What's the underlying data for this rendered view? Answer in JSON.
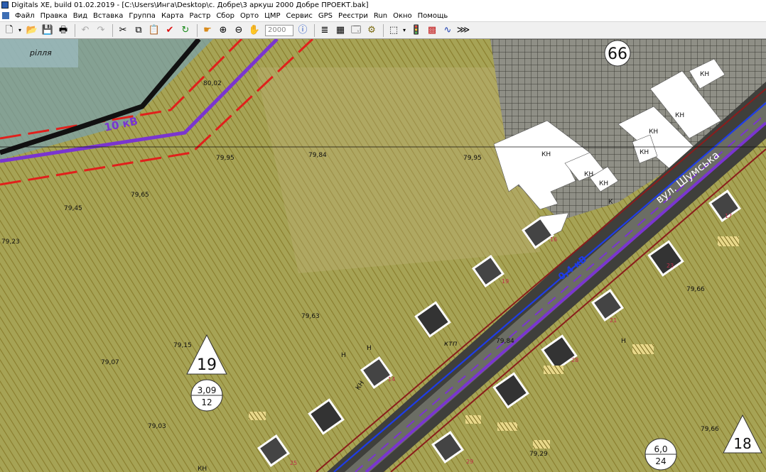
{
  "window": {
    "title": "Digitals XE, build 01.02.2019 - [C:\\Users\\Инга\\Desktop\\с. Добре\\3 аркуш 2000 Добре ПРОЕКТ.bak]"
  },
  "menu": [
    "Файл",
    "Правка",
    "Вид",
    "Вставка",
    "Группа",
    "Карта",
    "Растр",
    "Сбор",
    "Орто",
    "ЦМР",
    "Сервис",
    "GPS",
    "Реєстри",
    "Run",
    "Окно",
    "Помощь"
  ],
  "toolbar": {
    "zoom_value": "2000",
    "icons": [
      "new-file-icon",
      "open-folder-icon",
      "save-icon",
      "print-icon",
      "undo-icon",
      "redo-icon",
      "cut-icon",
      "copy-icon",
      "paste-icon",
      "check-icon",
      "refresh-icon",
      "pointer-hand-icon",
      "zoom-in-icon",
      "zoom-out-icon",
      "pan-hand-icon",
      "info-icon",
      "layers-icon",
      "table-icon",
      "properties-icon",
      "gear-icon",
      "select-arrow-icon",
      "traffic-light-icon",
      "raster-icon",
      "curve-icon",
      "vector-icon"
    ]
  },
  "map": {
    "colors": {
      "field": "#a6a355",
      "hatch": "#8a7d2c",
      "red_line": "#e0201c",
      "purple_line": "#7a35d0",
      "blue_line": "#1e3ce8",
      "road": "#3b3b3b",
      "dark_red_border": "#8b1c1c"
    },
    "labels": {
      "field": "рілля",
      "street": "вул. Шумська",
      "power_line": "10 кВ",
      "power_line_road": "0,4 кВ",
      "block_66": "66",
      "block_19": "19",
      "block_18": "18",
      "area_19_top": "3,09",
      "area_19_bottom": "12",
      "area_18_top": "6,0",
      "area_18_bottom": "24",
      "tp": "ктп",
      "kn": "КН",
      "n": "Н",
      "k": "К"
    },
    "elevations": [
      {
        "value": "80,02"
      },
      {
        "value": "79,95"
      },
      {
        "value": "79,84"
      },
      {
        "value": "79,95"
      },
      {
        "value": "79,65"
      },
      {
        "value": "79,45"
      },
      {
        "value": "79,23"
      },
      {
        "value": "79,63"
      },
      {
        "value": "79,15"
      },
      {
        "value": "79,07"
      },
      {
        "value": "79,03"
      },
      {
        "value": "79,84"
      },
      {
        "value": "79,66"
      },
      {
        "value": "79,29"
      },
      {
        "value": "79,66"
      }
    ],
    "house_numbers": [
      "16",
      "19",
      "21",
      "14",
      "17",
      "23",
      "28",
      "29",
      "25"
    ]
  }
}
